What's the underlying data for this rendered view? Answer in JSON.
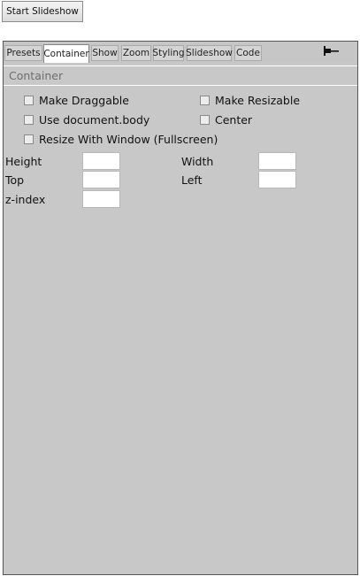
{
  "start_button_label": "Start Slideshow",
  "tabs": [
    {
      "label": "Presets"
    },
    {
      "label": "Container"
    },
    {
      "label": "Show"
    },
    {
      "label": "Zoom"
    },
    {
      "label": "Styling"
    },
    {
      "label": "Slideshow"
    },
    {
      "label": "Code"
    }
  ],
  "active_tab": "Container",
  "pin_icon": "pin-icon",
  "section_title": "Container",
  "checkboxes": {
    "make_draggable": {
      "label": "Make Draggable",
      "checked": false
    },
    "make_resizable": {
      "label": "Make Resizable",
      "checked": false
    },
    "use_document_body": {
      "label": "Use document.body",
      "checked": false
    },
    "center": {
      "label": "Center",
      "checked": false
    },
    "resize_with_window": {
      "label": "Resize With Window (Fullscreen)",
      "checked": false
    }
  },
  "fields": {
    "height": {
      "label": "Height",
      "value": ""
    },
    "width": {
      "label": "Width",
      "value": ""
    },
    "top": {
      "label": "Top",
      "value": ""
    },
    "left": {
      "label": "Left",
      "value": ""
    },
    "zindex": {
      "label": "z-index",
      "value": ""
    }
  },
  "colors": {
    "panel_bg": "#c8c8c8",
    "active_tab_bg": "#ffffff",
    "section_title": "#6e6e6e"
  }
}
